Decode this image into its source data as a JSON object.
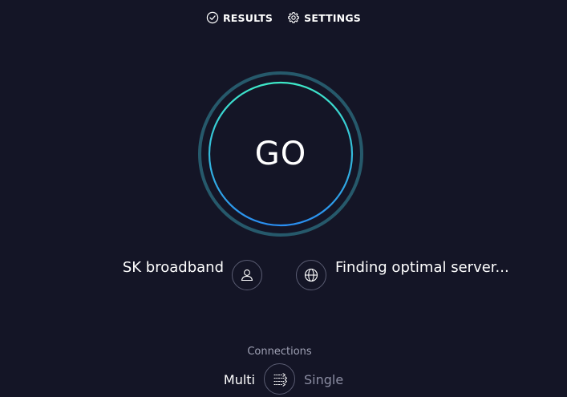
{
  "nav": {
    "results_label": "RESULTS",
    "settings_label": "SETTINGS"
  },
  "go_button": {
    "label": "GO"
  },
  "isp": {
    "name": "SK broadband"
  },
  "server": {
    "status": "Finding optimal server..."
  },
  "connections": {
    "title": "Connections",
    "selected": "Multi",
    "options": [
      "Multi",
      "Single"
    ]
  },
  "colors": {
    "background": "#141526",
    "ring_outer": "#26596b",
    "ring_gradient_top": "#3ee8c8",
    "ring_gradient_bottom": "#2a8ef0",
    "muted_text": "#9fa1b4"
  },
  "icons": {
    "results": "check-circle-icon",
    "settings": "gear-icon",
    "isp": "user-icon",
    "server": "globe-icon",
    "connections": "multi-arrows-icon"
  }
}
